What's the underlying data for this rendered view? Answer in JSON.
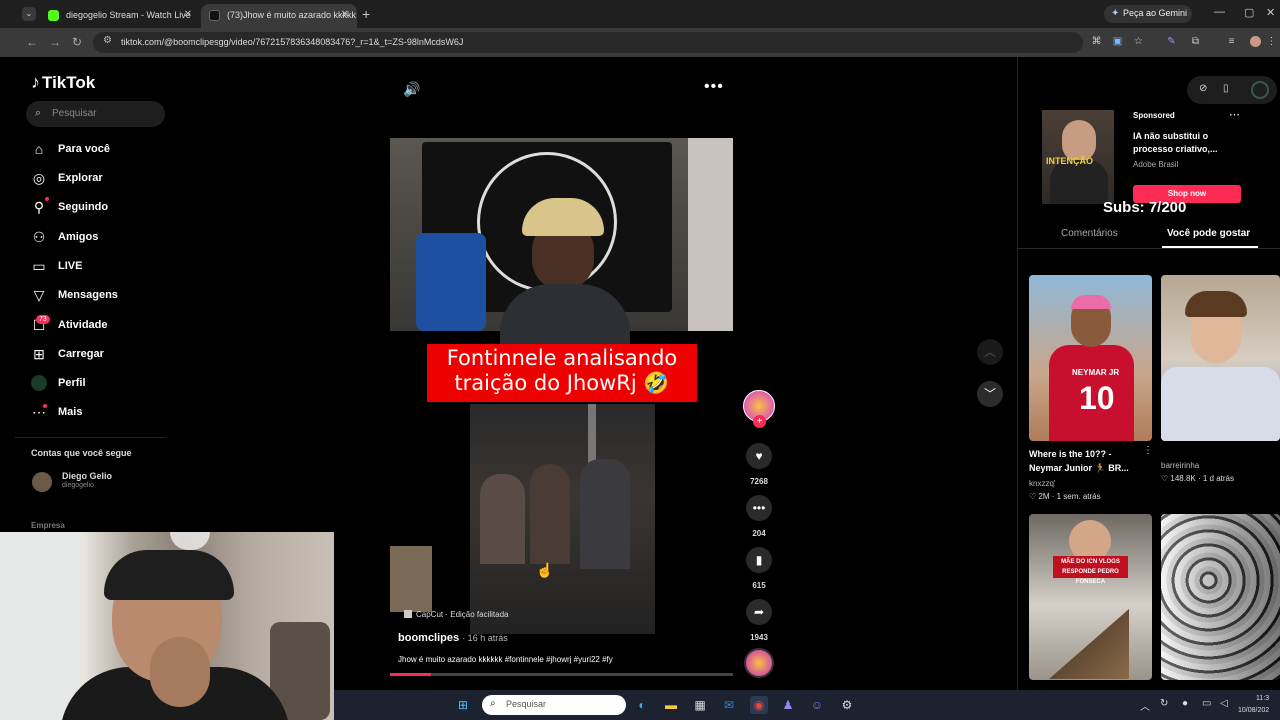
{
  "browser": {
    "tabs": [
      {
        "label": "diegogelio Stream - Watch Live",
        "active": false
      },
      {
        "label": "(73)Jhow é muito azarado kkkkk",
        "active": true
      }
    ],
    "url": "tiktok.com/@boomclipesgg/video/7672157836348083476?_r=1&_t=ZS-98lnMcdsW6J",
    "gemini_label": "Peça ao Gemini"
  },
  "sidebar": {
    "logo": "TikTok",
    "search_placeholder": "Pesquisar",
    "items": [
      {
        "label": "Para você",
        "icon": "home-icon"
      },
      {
        "label": "Explorar",
        "icon": "compass-icon"
      },
      {
        "label": "Seguindo",
        "icon": "user-follow-icon"
      },
      {
        "label": "Amigos",
        "icon": "friends-icon"
      },
      {
        "label": "LIVE",
        "icon": "live-icon"
      },
      {
        "label": "Mensagens",
        "icon": "send-icon"
      },
      {
        "label": "Atividade",
        "icon": "inbox-icon"
      },
      {
        "label": "Carregar",
        "icon": "upload-icon"
      },
      {
        "label": "Perfil",
        "icon": "avatar"
      },
      {
        "label": "Mais",
        "icon": "more-icon"
      }
    ],
    "activity_badge": "73",
    "following_header": "Contas que você segue",
    "following": [
      {
        "name": "Diego Gelio",
        "handle": "diegogelio"
      }
    ],
    "company_label": "Empresa"
  },
  "video": {
    "caption_line1": "Fontinnele analisando",
    "caption_line2": "traição do JhowRj 🤣",
    "capcut_label": "CapCut · Edição facilitada",
    "author": "boomclipes",
    "time_ago": "· 16 h atrás",
    "description": "Jhow é muito azarado kkkkkk #fontinnele #jhowrj #yuri22 #fy",
    "progress": 0.12
  },
  "actions": {
    "likes": "7268",
    "comments": "204",
    "saves": "615",
    "shares": "1943"
  },
  "right_panel": {
    "ad": {
      "sponsored": "Sponsored",
      "image_text": "INTENÇÃO",
      "title": "IA não substitui o processo criativo,...",
      "brand": "Adobe Brasil",
      "cta": "Shop now"
    },
    "subs_overlay": "Subs: 7/200",
    "tabs": [
      "Comentários",
      "Você pode gostar"
    ],
    "active_tab": "Você pode gostar",
    "cards": [
      {
        "title": "Where is the 10?? - Neymar Junior 🏃 BR...",
        "user": "knxzzq'",
        "stats": "♡ 2M · 1 sem. atrás",
        "image_text": "NEYMAR JR",
        "number": "10"
      },
      {
        "title": "",
        "user": "barreirinha",
        "stats": "♡ 148.8K · 1 d atrás"
      },
      {
        "image_text": "MÃE DO ICN VLOGS RESPONDE PEDRO FONSECA"
      },
      {}
    ]
  },
  "taskbar": {
    "search_placeholder": "Pesquisar",
    "time": "11:3",
    "date": "10/08/202"
  }
}
